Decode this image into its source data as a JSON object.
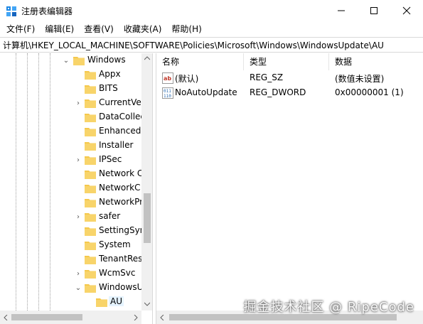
{
  "window": {
    "title": "注册表编辑器",
    "icon": "regedit-icon"
  },
  "menu": [
    {
      "label": "文件(F)"
    },
    {
      "label": "编辑(E)"
    },
    {
      "label": "查看(V)"
    },
    {
      "label": "收藏夹(A)"
    },
    {
      "label": "帮助(H)"
    }
  ],
  "address": "计算机\\HKEY_LOCAL_MACHINE\\SOFTWARE\\Policies\\Microsoft\\Windows\\WindowsUpdate\\AU",
  "tree": {
    "parent": {
      "label": "Windows",
      "expanded": true
    },
    "children": [
      {
        "label": "Appx",
        "has_children": false
      },
      {
        "label": "BITS",
        "has_children": false
      },
      {
        "label": "CurrentVe",
        "has_children": true
      },
      {
        "label": "DataCollec",
        "has_children": false
      },
      {
        "label": "EnhancedS",
        "has_children": false
      },
      {
        "label": "Installer",
        "has_children": false
      },
      {
        "label": "IPSec",
        "has_children": true
      },
      {
        "label": "Network C",
        "has_children": false
      },
      {
        "label": "NetworkC",
        "has_children": false
      },
      {
        "label": "NetworkPr",
        "has_children": false
      },
      {
        "label": "safer",
        "has_children": true
      },
      {
        "label": "SettingSyn",
        "has_children": false
      },
      {
        "label": "System",
        "has_children": false
      },
      {
        "label": "TenantRes",
        "has_children": false
      },
      {
        "label": "WcmSvc",
        "has_children": true
      },
      {
        "label": "WindowsU",
        "has_children": true,
        "expanded": true
      }
    ],
    "grandchild": {
      "label": "AU",
      "selected": true
    }
  },
  "list": {
    "columns": [
      "名称",
      "类型",
      "数据"
    ],
    "rows": [
      {
        "name": "(默认)",
        "type": "REG_SZ",
        "data": "(数值未设置)",
        "icon": "string-value-icon"
      },
      {
        "name": "NoAutoUpdate",
        "type": "REG_DWORD",
        "data": "0x00000001 (1)",
        "icon": "binary-value-icon"
      }
    ]
  },
  "watermark": "掘金技术社区 @ RipeCode",
  "colors": {
    "folder": "#f5c84c",
    "selection": "#e5f3ff",
    "string_icon": "#c0392b",
    "binary_icon": "#2f6fb5"
  }
}
